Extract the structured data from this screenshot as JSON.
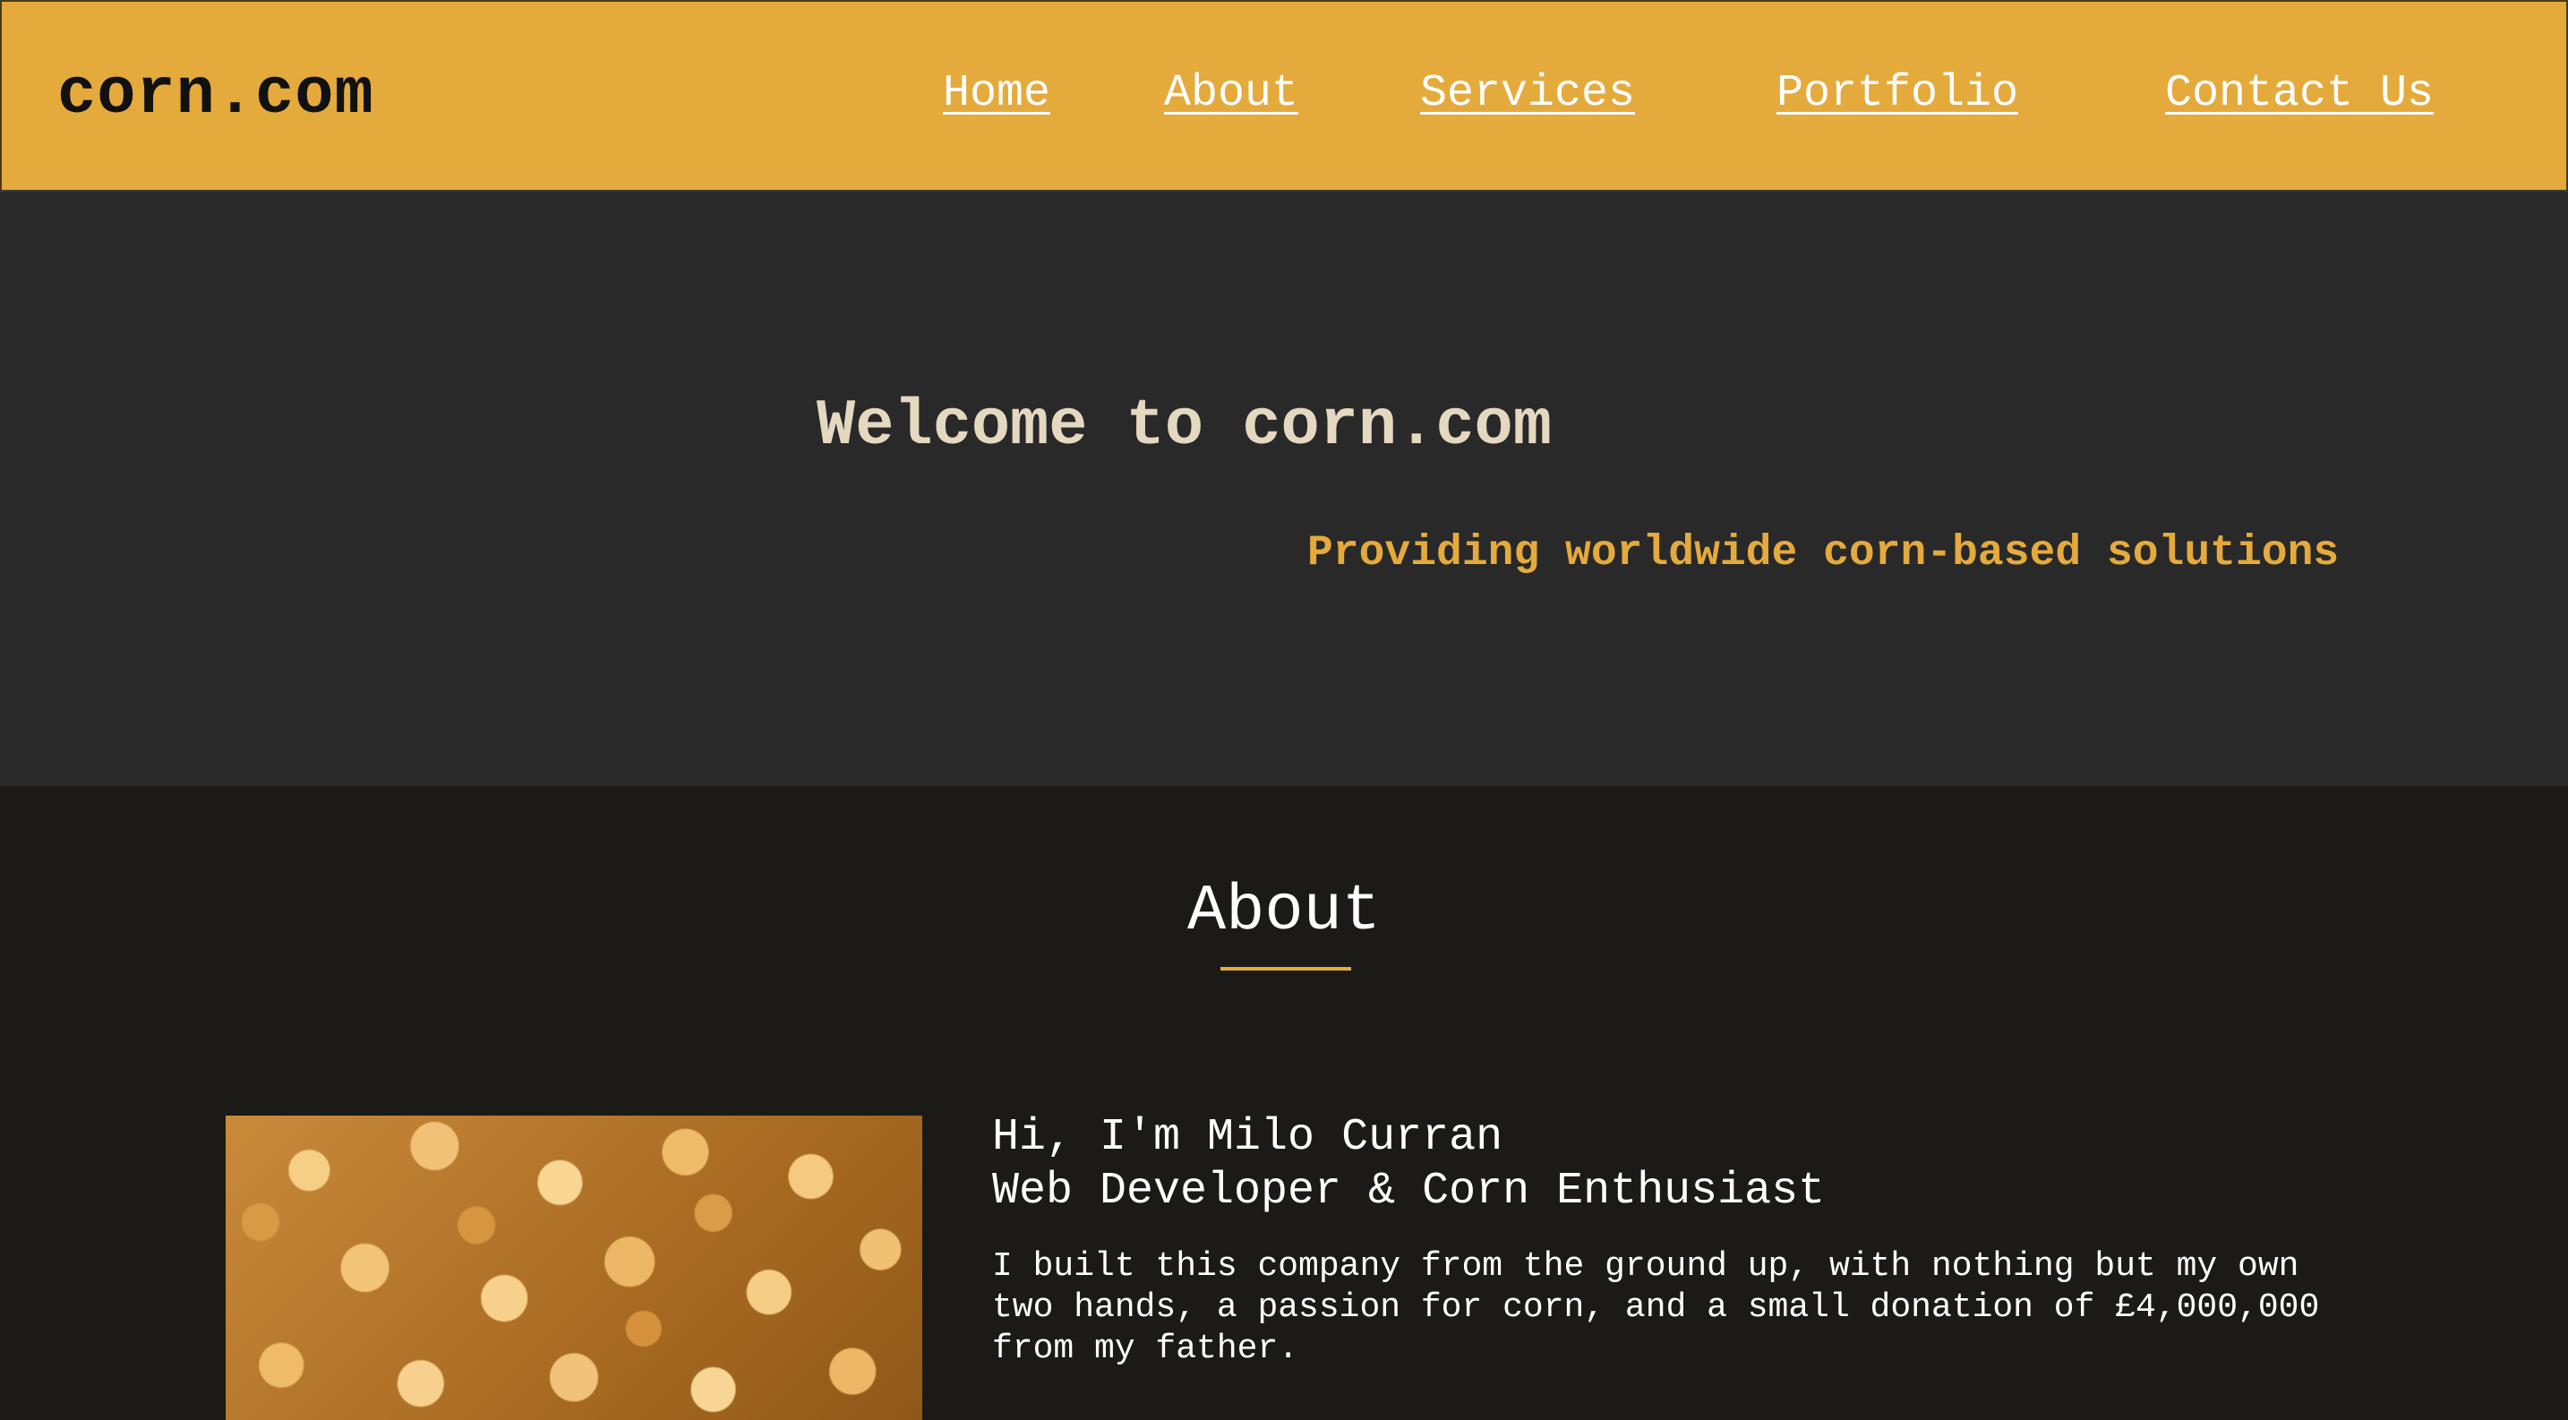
{
  "header": {
    "logo": "corn.com",
    "nav": {
      "home": "Home",
      "about": "About",
      "services": "Services",
      "portfolio": "Portfolio",
      "contact": "Contact Us"
    }
  },
  "hero": {
    "title": "Welcome to corn.com",
    "tagline": "Providing worldwide corn-based solutions"
  },
  "about": {
    "heading": "About",
    "intro_name": "Hi, I'm Milo Curran",
    "intro_title": "Web Developer & Corn Enthusiast",
    "bio": "I built this company from the ground up, with nothing but my own two hands, a passion for corn, and a small donation of £4,000,000 from my father."
  },
  "colors": {
    "accent": "#e5aa3c",
    "hero_bg": "#29292a",
    "about_bg": "#1b1a17",
    "hero_title": "#e5d8c0"
  },
  "images": {
    "about_photo": "corn-kernels-photo"
  }
}
